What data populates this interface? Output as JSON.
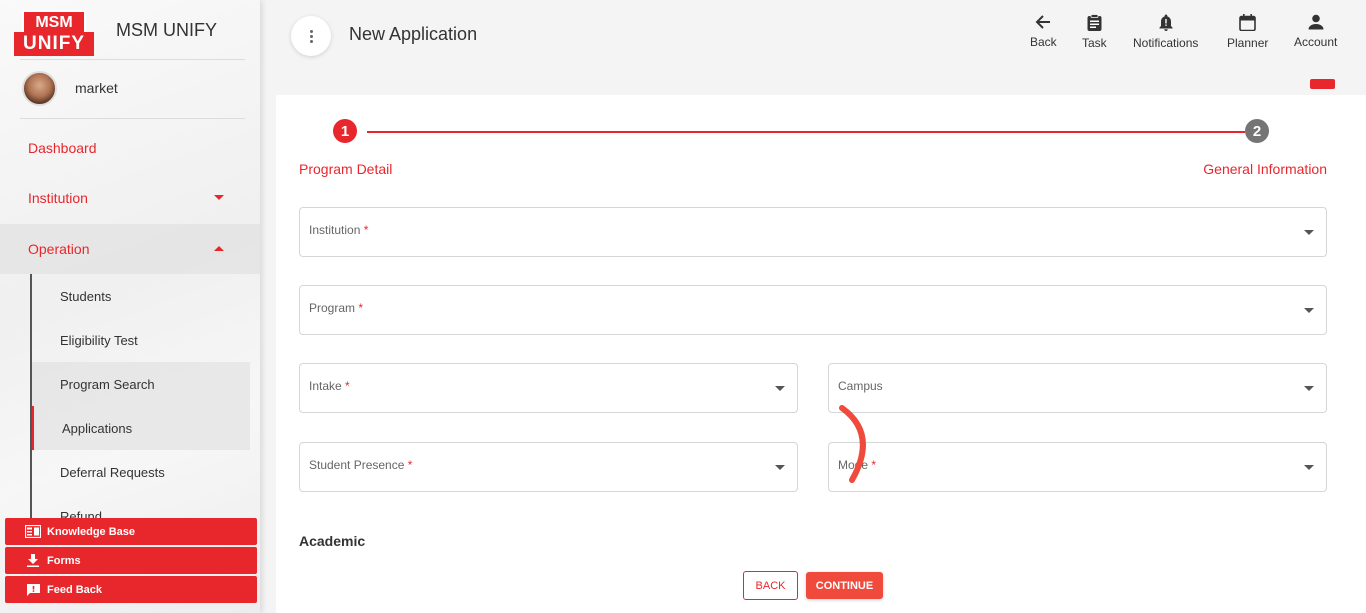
{
  "app": {
    "logo_top": "MSM",
    "logo_bottom": "UNIFY",
    "name": "MSM UNIFY"
  },
  "user": {
    "name": "market"
  },
  "sidebar": {
    "nav": [
      {
        "label": "Dashboard"
      },
      {
        "label": "Institution"
      },
      {
        "label": "Operation"
      }
    ],
    "operation_items": [
      {
        "label": "Students"
      },
      {
        "label": "Eligibility Test"
      },
      {
        "label": "Program Search"
      },
      {
        "label": "Applications"
      },
      {
        "label": "Deferral Requests"
      },
      {
        "label": "Refund"
      }
    ],
    "quick_links": [
      {
        "label": "Knowledge Base",
        "icon": "book-icon"
      },
      {
        "label": "Forms",
        "icon": "download-icon"
      },
      {
        "label": "Feed Back",
        "icon": "feedback-icon"
      }
    ]
  },
  "header": {
    "title": "New Application",
    "tools": [
      {
        "label": "Back",
        "icon": "arrow-left-icon"
      },
      {
        "label": "Task",
        "icon": "clipboard-icon"
      },
      {
        "label": "Notifications",
        "icon": "bell-icon"
      },
      {
        "label": "Planner",
        "icon": "calendar-icon"
      },
      {
        "label": "Account",
        "icon": "person-icon"
      }
    ]
  },
  "stepper": {
    "steps": [
      {
        "number": "1",
        "label": "Program Detail",
        "state": "active"
      },
      {
        "number": "2",
        "label": "General Information",
        "state": "pending"
      }
    ]
  },
  "form": {
    "fields": {
      "institution": {
        "label": "Institution",
        "required": "*"
      },
      "program": {
        "label": "Program",
        "required": "*"
      },
      "intake": {
        "label": "Intake",
        "required": "*"
      },
      "campus": {
        "label": "Campus",
        "required": ""
      },
      "student_presence": {
        "label": "Student Presence",
        "required": "*"
      },
      "mode": {
        "label": "Mode",
        "required": "*"
      }
    },
    "section_title": "Academic",
    "back_label": "BACK",
    "continue_label": "CONTINUE"
  },
  "colors": {
    "accent": "#e8272c",
    "step_pending": "#757575",
    "continue_bg": "#f04a3c"
  }
}
